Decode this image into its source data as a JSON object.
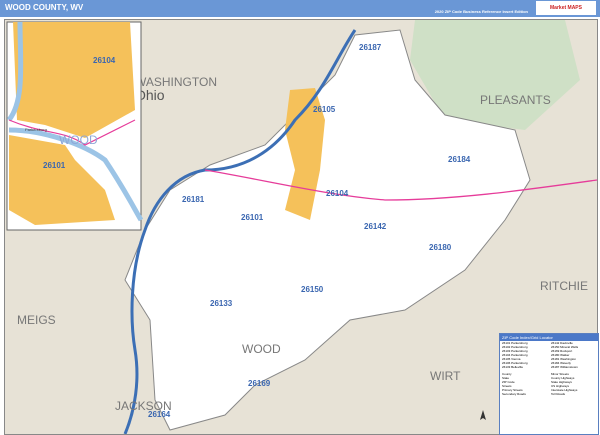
{
  "header": {
    "title": "WOOD COUNTY, WV",
    "subtitle": "2020 ZIP Code Business Reference Insert Edition",
    "logo": "Market MAPS"
  },
  "map": {
    "counties": [
      "WASHINGTON",
      "PLEASANTS",
      "RITCHIE",
      "WIRT",
      "MEIGS",
      "JACKSON",
      "WOOD"
    ],
    "state": "Ohio",
    "zips": [
      "26187",
      "26105",
      "26184",
      "26104",
      "26181",
      "26101",
      "26142",
      "26180",
      "26133",
      "26150",
      "26169",
      "26164"
    ],
    "inset": {
      "zips": [
        "26104",
        "26101"
      ],
      "county": "WOOD",
      "city": "Parkersburg"
    },
    "colors": {
      "land": "#e7e2d6",
      "county": "#ffffff",
      "urban": "#f5c15a",
      "water": "#9cc4e6",
      "river": "#3c6fb5",
      "highway": "#e63c9a",
      "zipline": "#3b73b9"
    }
  },
  "legend": {
    "title": "ZIP Code Index/Grid Locator",
    "entries": [
      "26101 Parkersburg",
      "26102 Parkersburg",
      "26103 Parkersburg",
      "26104 Parkersburg",
      "26105 Vienna",
      "26106 Parkersburg",
      "26133 Belleville",
      "26142 Davisville",
      "26150 Mineral Wells",
      "26169 Rockport",
      "26180 Walker",
      "26181 Washington",
      "26184 Waverly",
      "26187 Williamstown"
    ],
    "items": [
      "County",
      "State",
      "ZIP Code",
      "Streets",
      "Primary Streets",
      "Secondary Roads",
      "Minor Streets",
      "County Highways",
      "State Highways",
      "US Highways",
      "Interstate Highways",
      "Toll Roads"
    ]
  }
}
